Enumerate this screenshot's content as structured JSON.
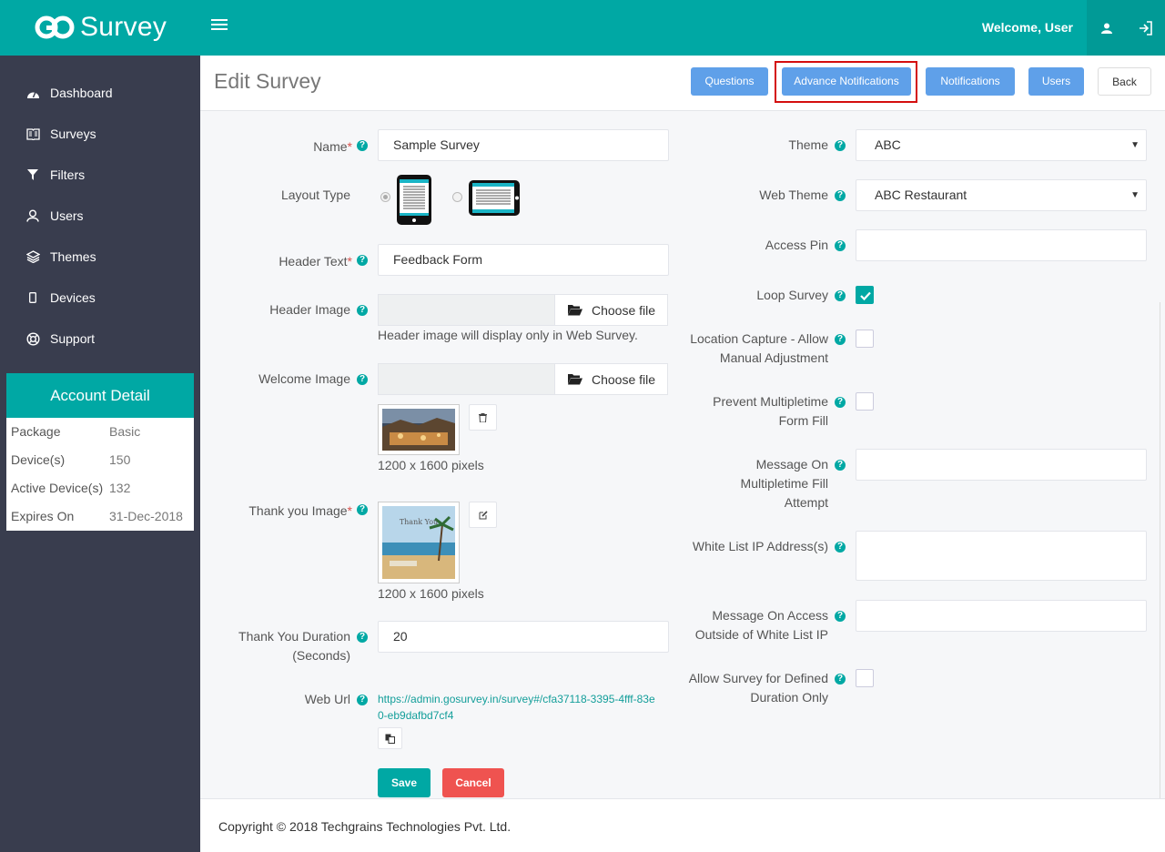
{
  "header": {
    "brand": "Survey",
    "welcome": "Welcome, User"
  },
  "sidebar": {
    "items": [
      {
        "label": "Dashboard",
        "icon": "dashboard-icon"
      },
      {
        "label": "Surveys",
        "icon": "book-icon"
      },
      {
        "label": "Filters",
        "icon": "filter-icon"
      },
      {
        "label": "Users",
        "icon": "user-icon"
      },
      {
        "label": "Themes",
        "icon": "layers-icon"
      },
      {
        "label": "Devices",
        "icon": "mobile-icon"
      },
      {
        "label": "Support",
        "icon": "lifebuoy-icon"
      }
    ],
    "account": {
      "title": "Account Detail",
      "rows": [
        {
          "key": "Package",
          "value": "Basic"
        },
        {
          "key": "Device(s)",
          "value": "150"
        },
        {
          "key": "Active Device(s)",
          "value": "132"
        },
        {
          "key": "Expires On",
          "value": "31-Dec-2018"
        }
      ]
    }
  },
  "page": {
    "title": "Edit Survey",
    "buttons": {
      "questions": "Questions",
      "advance_notifications": "Advance Notifications",
      "notifications": "Notifications",
      "users": "Users",
      "back": "Back"
    }
  },
  "form": {
    "name_label": "Name",
    "name_value": "Sample Survey",
    "layout_label": "Layout Type",
    "header_text_label": "Header Text",
    "header_text_value": "Feedback Form",
    "header_image_label": "Header Image",
    "choose_file": "Choose file",
    "header_image_hint": "Header image will display only in Web Survey.",
    "welcome_image_label": "Welcome Image",
    "welcome_dims": "1200 x 1600 pixels",
    "thank_image_label": "Thank you Image",
    "thank_dims": "1200 x 1600 pixels",
    "thank_img_text": "Thank You",
    "duration_label_1": "Thank You Duration",
    "duration_label_2": "(Seconds)",
    "duration_value": "20",
    "web_url_label": "Web Url",
    "web_url": "https://admin.gosurvey.in/survey#/cfa37118-3395-4fff-83e0-eb9dafbd7cf4",
    "save": "Save",
    "cancel": "Cancel",
    "theme_label": "Theme",
    "theme_value": "ABC",
    "web_theme_label": "Web Theme",
    "web_theme_value": "ABC Restaurant",
    "access_pin_label": "Access Pin",
    "loop_label": "Loop Survey",
    "location_label_1": "Location Capture - Allow",
    "location_label_2": "Manual Adjustment",
    "prevent_label_1": "Prevent Multipletime",
    "prevent_label_2": "Form Fill",
    "msg_multi_1": "Message On",
    "msg_multi_2": "Multipletime Fill",
    "msg_multi_3": "Attempt",
    "whitelist_label": "White List IP Address(s)",
    "msg_access_1": "Message On Access",
    "msg_access_2": "Outside of White List IP",
    "allow_duration_1": "Allow Survey for Defined",
    "allow_duration_2": "Duration Only",
    "loop_checked": true
  },
  "footer": {
    "copyright": "Copyright © 2018 Techgrains Technologies Pvt. Ltd."
  },
  "colors": {
    "brand": "#00a8a4",
    "sidebar": "#393d4e",
    "button_blue": "#5fa0e9",
    "cancel_red": "#ef5350",
    "highlight_red": "#d40e0e"
  }
}
